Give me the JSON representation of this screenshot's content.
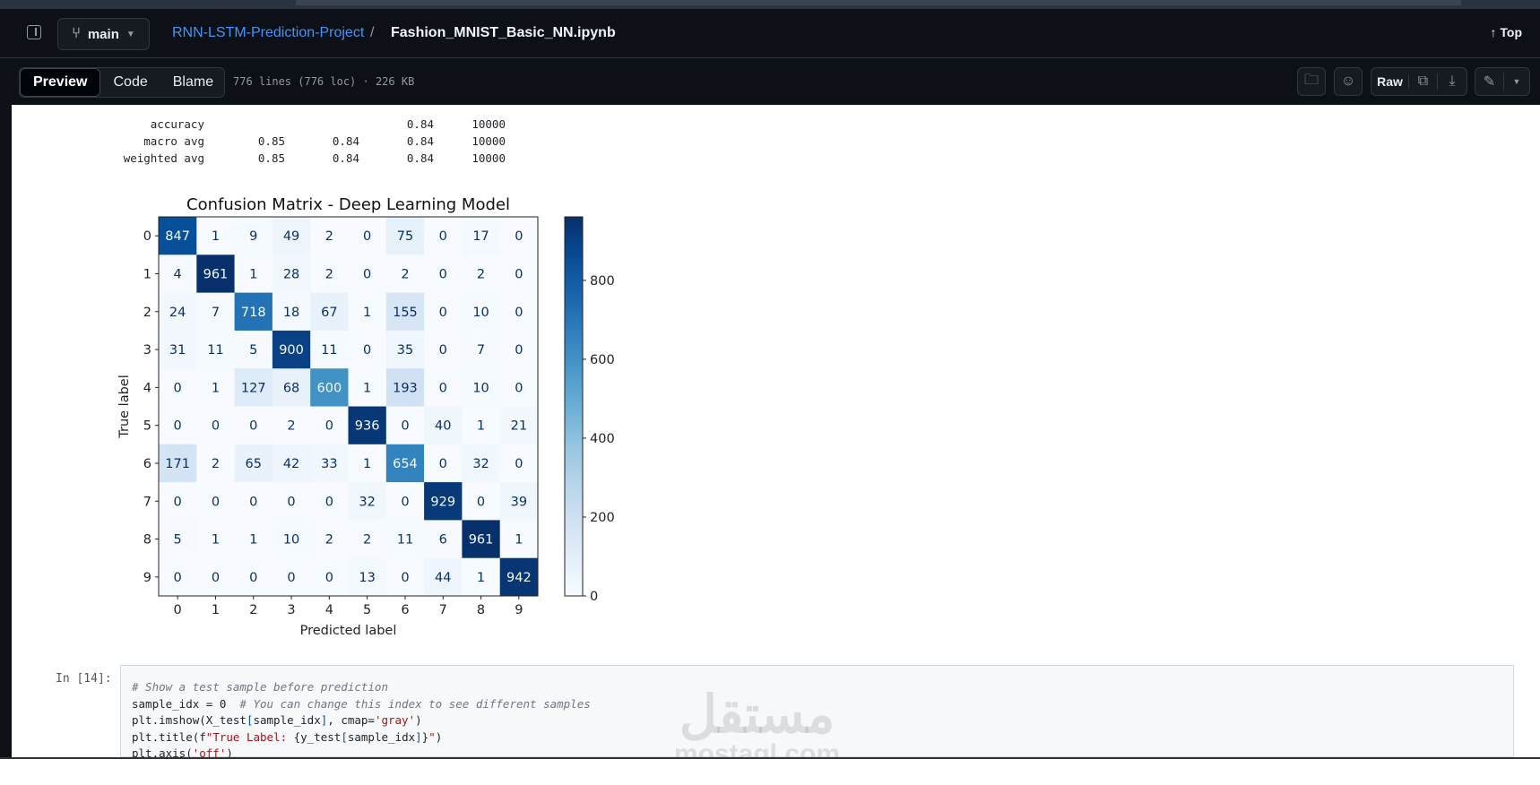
{
  "header": {
    "branch": "main",
    "repo": "RNN-LSTM-Prediction-Project",
    "separator": "/",
    "file": "Fashion_MNIST_Basic_NN.ipynb",
    "top_label": "↑ Top"
  },
  "toolbar": {
    "tabs": [
      "Preview",
      "Code",
      "Blame"
    ],
    "active_tab": "Preview",
    "meta": "776 lines (776 loc) · 226 KB",
    "raw_label": "Raw"
  },
  "report": {
    "rows": [
      {
        "label": "accuracy",
        "precision": "",
        "recall": "",
        "f1": "0.84",
        "support": "10000"
      },
      {
        "label": "macro avg",
        "precision": "0.85",
        "recall": "0.84",
        "f1": "0.84",
        "support": "10000"
      },
      {
        "label": "weighted avg",
        "precision": "0.85",
        "recall": "0.84",
        "f1": "0.84",
        "support": "10000"
      }
    ]
  },
  "chart_data": {
    "type": "heatmap",
    "title": "Confusion Matrix - Deep Learning Model",
    "xlabel": "Predicted label",
    "ylabel": "True label",
    "x_ticks": [
      "0",
      "1",
      "2",
      "3",
      "4",
      "5",
      "6",
      "7",
      "8",
      "9"
    ],
    "y_ticks": [
      "0",
      "1",
      "2",
      "3",
      "4",
      "5",
      "6",
      "7",
      "8",
      "9"
    ],
    "colormap": "Blues",
    "colorbar_range": [
      0,
      961
    ],
    "colorbar_ticks": [
      0,
      200,
      400,
      600,
      800
    ],
    "values": [
      [
        847,
        1,
        9,
        49,
        2,
        0,
        75,
        0,
        17,
        0
      ],
      [
        4,
        961,
        1,
        28,
        2,
        0,
        2,
        0,
        2,
        0
      ],
      [
        24,
        7,
        718,
        18,
        67,
        1,
        155,
        0,
        10,
        0
      ],
      [
        31,
        11,
        5,
        900,
        11,
        0,
        35,
        0,
        7,
        0
      ],
      [
        0,
        1,
        127,
        68,
        600,
        1,
        193,
        0,
        10,
        0
      ],
      [
        0,
        0,
        0,
        2,
        0,
        936,
        0,
        40,
        1,
        21
      ],
      [
        171,
        2,
        65,
        42,
        33,
        1,
        654,
        0,
        32,
        0
      ],
      [
        0,
        0,
        0,
        0,
        0,
        32,
        0,
        929,
        0,
        39
      ],
      [
        5,
        1,
        1,
        10,
        2,
        2,
        11,
        6,
        961,
        1
      ],
      [
        0,
        0,
        0,
        0,
        0,
        13,
        0,
        44,
        1,
        942
      ]
    ]
  },
  "cell": {
    "prompt": "In [14]:",
    "lines": [
      {
        "parts": [
          {
            "t": "# Show a test sample before prediction",
            "c": "cm"
          }
        ]
      },
      {
        "parts": [
          {
            "t": "sample_idx = 0  ",
            "c": ""
          },
          {
            "t": "# You can change this index to see different samples",
            "c": "cm"
          }
        ]
      },
      {
        "parts": [
          {
            "t": "plt.imshow(X_test",
            "c": ""
          },
          {
            "t": "[",
            "c": "br"
          },
          {
            "t": "sample_idx",
            "c": ""
          },
          {
            "t": "]",
            "c": "br"
          },
          {
            "t": ", cmap=",
            "c": ""
          },
          {
            "t": "'gray'",
            "c": "st"
          },
          {
            "t": ")",
            "c": ""
          }
        ]
      },
      {
        "parts": [
          {
            "t": "plt.title(f",
            "c": ""
          },
          {
            "t": "\"True Label: ",
            "c": "st"
          },
          {
            "t": "{y_test",
            "c": ""
          },
          {
            "t": "[",
            "c": "br"
          },
          {
            "t": "sample_idx",
            "c": ""
          },
          {
            "t": "]",
            "c": "br"
          },
          {
            "t": "}",
            "c": ""
          },
          {
            "t": "\"",
            "c": "st"
          },
          {
            "t": ")",
            "c": ""
          }
        ]
      },
      {
        "parts": [
          {
            "t": "plt.axis(",
            "c": ""
          },
          {
            "t": "'off'",
            "c": "st"
          },
          {
            "t": ")",
            "c": ""
          }
        ]
      }
    ]
  },
  "watermark": {
    "arabic": "مستقل",
    "latin": "mostaql.com"
  }
}
